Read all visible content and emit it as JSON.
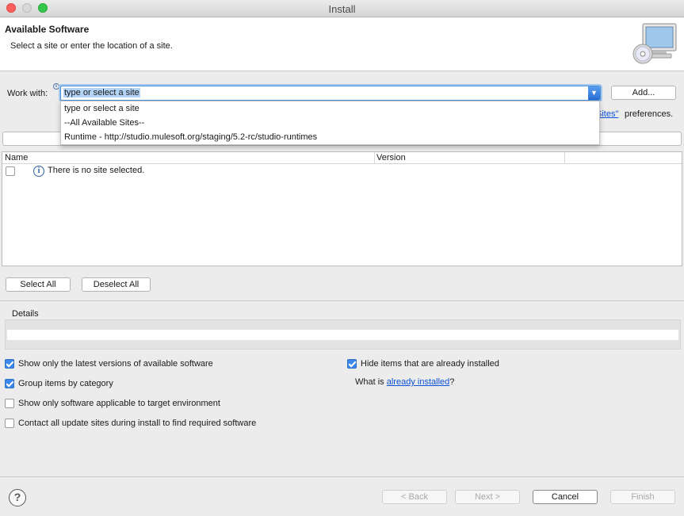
{
  "window": {
    "title": "Install"
  },
  "banner": {
    "title": "Available Software",
    "description": "Select a site or enter the location of a site."
  },
  "work_with": {
    "label": "Work with:",
    "value": "type or select a site",
    "add_button": "Add...",
    "dropdown_options": [
      "type or select a site",
      "--All Available Sites--",
      "Runtime - http://studio.mulesoft.org/staging/5.2-rc/studio-runtimes"
    ],
    "prefs_link": "Sites\"",
    "prefs_text": "preferences."
  },
  "table": {
    "columns": [
      "Name",
      "Version"
    ],
    "rows": [
      {
        "text": "There is no site selected.",
        "checked": false
      }
    ]
  },
  "selection": {
    "select_all": "Select All",
    "deselect_all": "Deselect All"
  },
  "details": {
    "label": "Details"
  },
  "options": {
    "latest_versions": {
      "label": "Show only the latest versions of available software",
      "checked": true
    },
    "group_by_category": {
      "label": "Group items by category",
      "checked": true
    },
    "target_env": {
      "label": "Show only software applicable to target environment",
      "checked": false
    },
    "contact_sites": {
      "label": "Contact all update sites during install to find required software",
      "checked": false
    },
    "hide_installed": {
      "label": "Hide items that are already installed",
      "checked": true
    }
  },
  "already_installed": {
    "prefix": "What is",
    "link": "already installed",
    "suffix": "?"
  },
  "footer": {
    "back": "< Back",
    "next": "Next >",
    "cancel": "Cancel",
    "finish": "Finish"
  },
  "colors": {
    "accent": "#3b87ec",
    "link": "#0b50d8",
    "focus_ring": "#a6c8ee"
  }
}
